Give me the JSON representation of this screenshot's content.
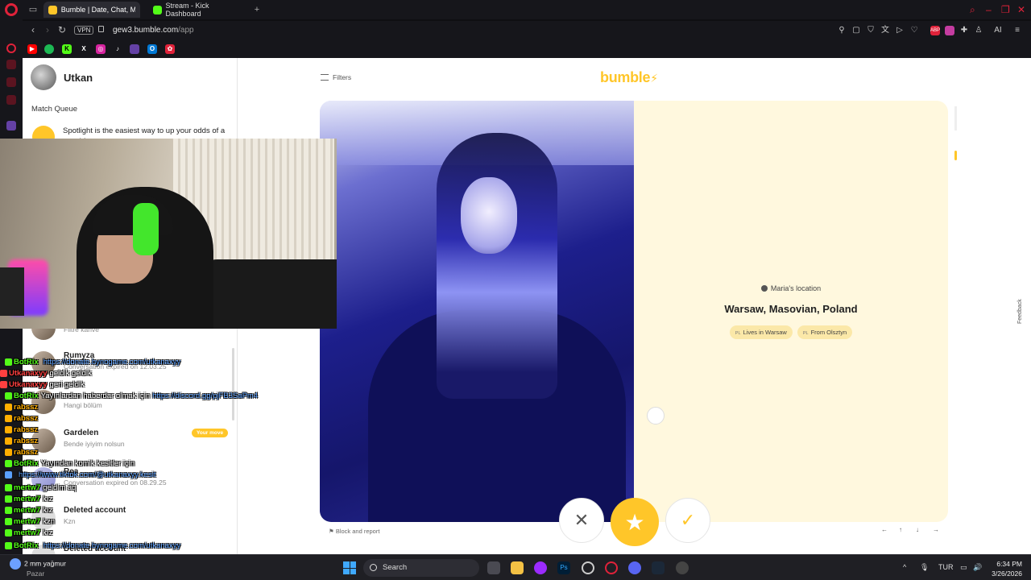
{
  "browser": {
    "tabs": [
      {
        "title": "Bumble | Date, Chat, Meet",
        "active": true
      },
      {
        "title": "Stream - Kick Dashboard",
        "active": false
      }
    ],
    "new_tab_symbol": "+",
    "close_symbol": "✕",
    "vpn_label": "VPN",
    "url_host": "gew3.bumble.com",
    "url_path": "/app",
    "ai_label": "AI",
    "bookmarks": [
      "youtube-icon",
      "spotify-icon",
      "kick-icon",
      "x-icon",
      "instagram-icon",
      "tiktok-icon",
      "twitch-icon",
      "outlook-icon",
      "extension-icon"
    ],
    "colors": {
      "opera_red": "#e0223a",
      "bumble_yellow": "#ffc629",
      "kick_green": "#53fc18"
    }
  },
  "bumble": {
    "user_name": "Utkan",
    "match_queue_title": "Match Queue",
    "spotlight_text": "Spotlight is the easiest way to up your odds of a match!",
    "conversations": [
      {
        "name": "",
        "subtitle": "Filtre kahve"
      },
      {
        "name": "Rumyza",
        "subtitle": "Conversation expired on 12.03.25"
      },
      {
        "name": "",
        "subtitle": "Hangi bölüm"
      },
      {
        "name": "Gardelen",
        "subtitle": "Bende iyiyim nolsun",
        "badge": "Your move"
      },
      {
        "name": "Rea",
        "subtitle": "Conversation expired on 08.29.25"
      },
      {
        "name": "Deleted account",
        "subtitle": "Kzn"
      },
      {
        "name": "Deleted account",
        "subtitle": ""
      }
    ],
    "filters_label": "Filters",
    "logo_text": "bumble",
    "location_heading": "Maria's location",
    "location_city": "Warsaw, Masovian, Poland",
    "tags": [
      {
        "cc": "PL",
        "text": "Lives in Warsaw"
      },
      {
        "cc": "PL",
        "text": "From Olsztyn"
      }
    ],
    "report_label": "Block and report",
    "actions": {
      "pass": "✕",
      "superswipe": "★",
      "like": "✓"
    },
    "keyboard_hints": [
      "←",
      "↑",
      "↓",
      "→"
    ],
    "feedback_label": "Feedback"
  },
  "chat": [
    {
      "user": "BotRix",
      "color": "#53fc18",
      "msg": "",
      "link": "https://donate.bynogame.com/utkanaxyy"
    },
    {
      "user": "Utkanaxyy",
      "color": "#ff4040",
      "msg": "geldik geldik",
      "link": ""
    },
    {
      "user": "Utkanaxyy",
      "color": "#ff4040",
      "msg": "geri geldik",
      "link": ""
    },
    {
      "user": "BotRix",
      "color": "#53fc18",
      "msg": "Yayınlardan haberdar olmak için",
      "link": "https://discord.gg/pjFB3SaPm4"
    },
    {
      "user": "rabssz",
      "color": "#ffae00",
      "msg": "",
      "link": ""
    },
    {
      "user": "rabssz",
      "color": "#ffae00",
      "msg": "",
      "link": ""
    },
    {
      "user": "rabssz",
      "color": "#ffae00",
      "msg": "",
      "link": ""
    },
    {
      "user": "rabssz",
      "color": "#ffae00",
      "msg": "",
      "link": ""
    },
    {
      "user": "rabssz",
      "color": "#ffae00",
      "msg": "",
      "link": ""
    },
    {
      "user": "BotRix",
      "color": "#53fc18",
      "msg": "Yayından komik kesitler için",
      "link": ""
    },
    {
      "user": "",
      "color": "#5aa0ff",
      "msg": "",
      "link": "https://www.tiktok.com/@utkanaxyy.kesit"
    },
    {
      "user": "mertw7",
      "color": "#53fc18",
      "msg": "geldim aq",
      "link": ""
    },
    {
      "user": "mertw7",
      "color": "#53fc18",
      "msg": "kız",
      "link": ""
    },
    {
      "user": "mertw7",
      "color": "#53fc18",
      "msg": "kız",
      "link": ""
    },
    {
      "user": "mertw7",
      "color": "#53fc18",
      "msg": "kzn",
      "link": ""
    },
    {
      "user": "mertw7",
      "color": "#53fc18",
      "msg": "kız",
      "link": ""
    },
    {
      "user": "BotRix",
      "color": "#53fc18",
      "msg": "",
      "link": "https://donate.bynogame.com/utkanaxyy"
    }
  ],
  "taskbar": {
    "weather_temp": "2 mm yağmur",
    "weather_day": "Pazar",
    "search_placeholder": "Search",
    "language": "TUR",
    "time": "6:34 PM",
    "date": "3/26/2026"
  }
}
